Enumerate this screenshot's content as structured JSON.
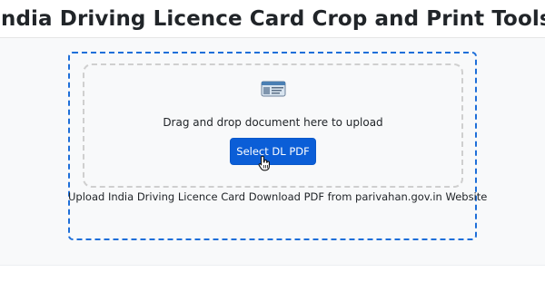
{
  "header": {
    "title": "India Driving Licence Card Crop and Print Tools"
  },
  "upload": {
    "icon": "id-card-icon",
    "drop_text": "Drag and drop document here to upload",
    "button_label": "Select DL PDF",
    "note": "Upload India Driving Licence Card Download PDF from parivahan.gov.in Website",
    "cursor_icon": "hand-pointer-icon"
  },
  "colors": {
    "button": "#0b5ed7",
    "outer_border": "#1e6fd9",
    "inner_border": "#cfcfcf",
    "background": "#f8f9fa"
  }
}
